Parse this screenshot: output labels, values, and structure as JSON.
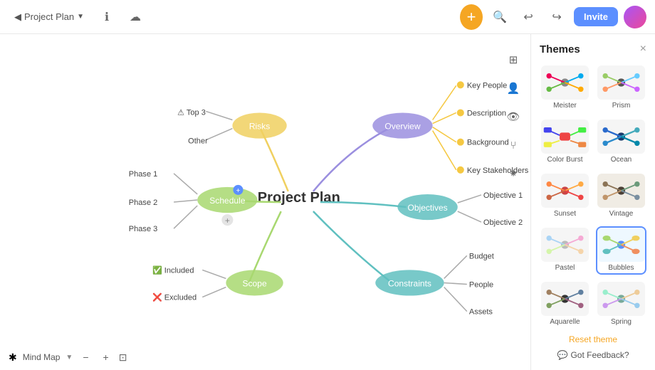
{
  "topbar": {
    "back_label": "Project Plan",
    "add_btn_label": "+",
    "invite_btn_label": "Invite"
  },
  "bottombar": {
    "mindmap_label": "Mind Map",
    "zoom_minus": "−",
    "zoom_plus": "+",
    "fit_icon": "⊡"
  },
  "themes": {
    "title": "Themes",
    "close": "×",
    "items": [
      {
        "name": "Meister",
        "active": false
      },
      {
        "name": "Prism",
        "active": false
      },
      {
        "name": "Color Burst",
        "active": false
      },
      {
        "name": "Ocean",
        "active": false
      },
      {
        "name": "Sunset",
        "active": false
      },
      {
        "name": "Vintage",
        "active": false
      },
      {
        "name": "Pastel",
        "active": false
      },
      {
        "name": "Bubbles",
        "active": true
      },
      {
        "name": "Aquarelle",
        "active": false
      },
      {
        "name": "Spring",
        "active": false
      }
    ],
    "reset_label": "Reset theme",
    "feedback_label": "Got Feedback?"
  },
  "mindmap": {
    "center": "Project Plan",
    "nodes": [
      {
        "id": "overview",
        "label": "Overview",
        "color": "#9b8fdf"
      },
      {
        "id": "risks",
        "label": "Risks",
        "color": "#f0d060"
      },
      {
        "id": "schedule",
        "label": "Schedule",
        "color": "#a8d870"
      },
      {
        "id": "objectives",
        "label": "Objectives",
        "color": "#60c0c0"
      },
      {
        "id": "scope",
        "label": "Scope",
        "color": "#a8d870"
      },
      {
        "id": "constraints",
        "label": "Constraints",
        "color": "#60c0c0"
      }
    ],
    "leaves": [
      {
        "parent": "overview",
        "label": "Key People"
      },
      {
        "parent": "overview",
        "label": "Description"
      },
      {
        "parent": "overview",
        "label": "Background"
      },
      {
        "parent": "overview",
        "label": "Key Stakeholders"
      },
      {
        "parent": "risks",
        "label": "⚠ Top 3"
      },
      {
        "parent": "risks",
        "label": "Other"
      },
      {
        "parent": "schedule",
        "label": "Phase 1"
      },
      {
        "parent": "schedule",
        "label": "Phase 2"
      },
      {
        "parent": "schedule",
        "label": "Phase 3"
      },
      {
        "parent": "objectives",
        "label": "Objective 1"
      },
      {
        "parent": "objectives",
        "label": "Objective 2"
      },
      {
        "parent": "scope",
        "label": "✅ Included"
      },
      {
        "parent": "scope",
        "label": "❌ Excluded"
      },
      {
        "parent": "constraints",
        "label": "Budget"
      },
      {
        "parent": "constraints",
        "label": "People"
      },
      {
        "parent": "constraints",
        "label": "Assets"
      }
    ]
  }
}
